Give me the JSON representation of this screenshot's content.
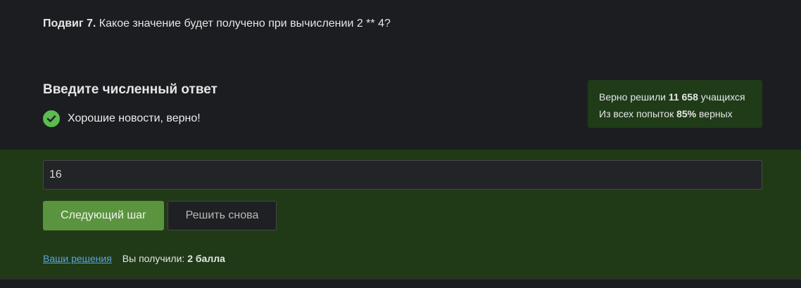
{
  "question": {
    "prefix": "Подвиг 7.",
    "text": " Какое значение будет получено при вычислении 2 ** 4?"
  },
  "answer": {
    "heading": "Введите численный ответ",
    "feedback": "Хорошие новости, верно!",
    "input_value": "16"
  },
  "stats": {
    "line1_prefix": "Верно решили ",
    "solved_count": "11 658",
    "line1_suffix": " учащихся",
    "line2_prefix": "Из всех попыток ",
    "correct_percent": "85%",
    "line2_suffix": " верных"
  },
  "buttons": {
    "next": "Следующий шаг",
    "retry": "Решить снова"
  },
  "footer": {
    "solutions_link": "Ваши решения",
    "score_prefix": "Вы получили: ",
    "score_value": "2 балла"
  },
  "colors": {
    "page_bg": "#1c1d21",
    "answer_zone_bg": "#203a17",
    "success_green": "#5cbb51",
    "primary_button": "#5a943e",
    "link": "#5aa3e0"
  }
}
